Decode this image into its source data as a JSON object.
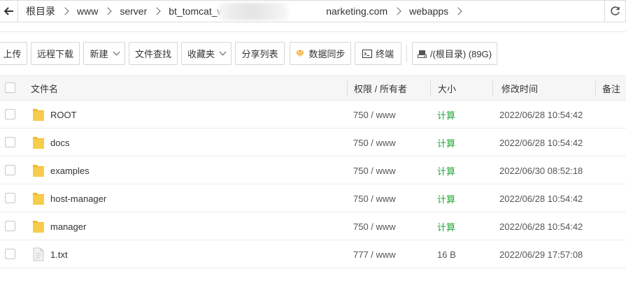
{
  "pathbar": {
    "crumbs": [
      "根目录",
      "www",
      "server",
      "bt_tomcat_web",
      "narketing.com",
      "webapps"
    ]
  },
  "toolbar": {
    "upload": "上传",
    "remote_download": "远程下载",
    "new": "新建",
    "file_search": "文件查找",
    "favorites": "收藏夹",
    "share_list": "分享列表",
    "data_sync": "数据同步",
    "terminal": "终端",
    "disk": "/(根目录) (89G)"
  },
  "table": {
    "headers": {
      "name": "文件名",
      "perm": "权限 / 所有者",
      "size": "大小",
      "mtime": "修改时间",
      "note": "备注"
    },
    "rows": [
      {
        "name": "ROOT",
        "perm": "750 / www",
        "size": "计算",
        "mtime": "2022/06/28 10:54:42",
        "type": "folder"
      },
      {
        "name": "docs",
        "perm": "750 / www",
        "size": "计算",
        "mtime": "2022/06/28 10:54:42",
        "type": "folder"
      },
      {
        "name": "examples",
        "perm": "750 / www",
        "size": "计算",
        "mtime": "2022/06/30 08:52:18",
        "type": "folder"
      },
      {
        "name": "host-manager",
        "perm": "750 / www",
        "size": "计算",
        "mtime": "2022/06/28 10:54:42",
        "type": "folder"
      },
      {
        "name": "manager",
        "perm": "750 / www",
        "size": "计算",
        "mtime": "2022/06/28 10:54:42",
        "type": "folder"
      },
      {
        "name": "1.txt",
        "perm": "777 / www",
        "size": "16 B",
        "mtime": "2022/06/29 17:57:08",
        "type": "file"
      }
    ]
  },
  "colors": {
    "accent_green": "#20a53a",
    "folder_yellow": "#f5c23c",
    "sync_orange": "#f4a41c"
  }
}
